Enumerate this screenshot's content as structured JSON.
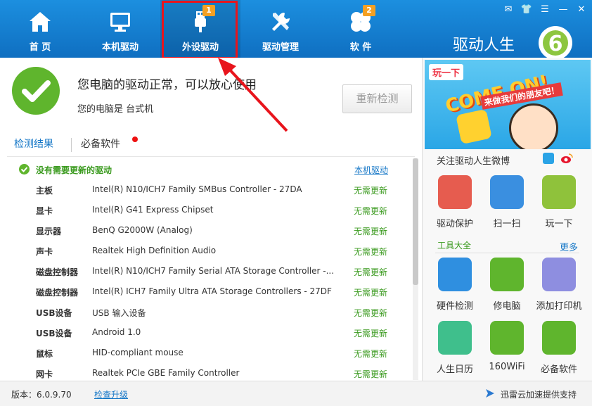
{
  "nav": {
    "items": [
      {
        "label": "首 页",
        "icon": "home-icon"
      },
      {
        "label": "本机驱动",
        "icon": "monitor-icon"
      },
      {
        "label": "外设驱动",
        "icon": "usb-icon",
        "badge": "1"
      },
      {
        "label": "驱动管理",
        "icon": "tools-icon"
      },
      {
        "label": "软 件",
        "icon": "clover-icon",
        "badge": "2"
      }
    ]
  },
  "brand": {
    "name": "驱动人生",
    "logo_digit": "6"
  },
  "status": {
    "title": "您电脑的驱动正常，可以放心使用",
    "subtitle": "您的电脑是 台式机",
    "recheck_button": "重新检测"
  },
  "tabs": {
    "results": "检测结果",
    "software": "必备软件"
  },
  "list": {
    "header": "没有需要更新的驱动",
    "header_link": "本机驱动",
    "rows": [
      {
        "category": "主板",
        "device": "Intel(R) N10/ICH7 Family SMBus Controller - 27DA",
        "status": "无需更新"
      },
      {
        "category": "显卡",
        "device": "Intel(R) G41 Express Chipset",
        "status": "无需更新"
      },
      {
        "category": "显示器",
        "device": "BenQ G2000W (Analog)",
        "status": "无需更新"
      },
      {
        "category": "声卡",
        "device": "Realtek High Definition Audio",
        "status": "无需更新"
      },
      {
        "category": "磁盘控制器",
        "device": "Intel(R) N10/ICH7 Family Serial ATA Storage Controller -...",
        "status": "无需更新"
      },
      {
        "category": "磁盘控制器",
        "device": "Intel(R) ICH7 Family Ultra ATA Storage Controllers - 27DF",
        "status": "无需更新"
      },
      {
        "category": "USB设备",
        "device": "USB 输入设备",
        "status": "无需更新"
      },
      {
        "category": "USB设备",
        "device": "Android 1.0",
        "status": "无需更新"
      },
      {
        "category": "鼠标",
        "device": "HID-compliant mouse",
        "status": "无需更新"
      },
      {
        "category": "网卡",
        "device": "Realtek PCIe GBE Family Controller",
        "status": "无需更新"
      }
    ]
  },
  "footer": {
    "version": "版本：6.0.9.70",
    "upgrade": "检查升级",
    "support": "迅雷云加速提供支持"
  },
  "sidebar": {
    "banner": {
      "tag": "玩一下",
      "headline": "COME ON!",
      "sub": "来做我们的朋友吧！"
    },
    "follow": "关注驱动人生微博",
    "top_tiles": [
      {
        "label": "驱动保护",
        "color": "#e65c4f"
      },
      {
        "label": "扫一扫",
        "color": "#3a8fe0"
      },
      {
        "label": "玩一下",
        "color": "#8fc23b"
      }
    ],
    "tools_header": "工具大全",
    "more": "更多",
    "tool_tiles": [
      {
        "label": "硬件检测",
        "color": "#2f8fe0"
      },
      {
        "label": "修电脑",
        "color": "#5fb52d"
      },
      {
        "label": "添加打印机",
        "color": "#8e8ee0"
      },
      {
        "label": "人生日历",
        "color": "#3fbf8c"
      },
      {
        "label": "160WiFi",
        "color": "#5fb52d"
      },
      {
        "label": "必备软件",
        "color": "#5fb52d"
      }
    ]
  },
  "colors": {
    "topbar": "#1580d3",
    "accent": "#1577c7",
    "ok_green": "#3a9a1e",
    "highlight": "#e8141c"
  }
}
